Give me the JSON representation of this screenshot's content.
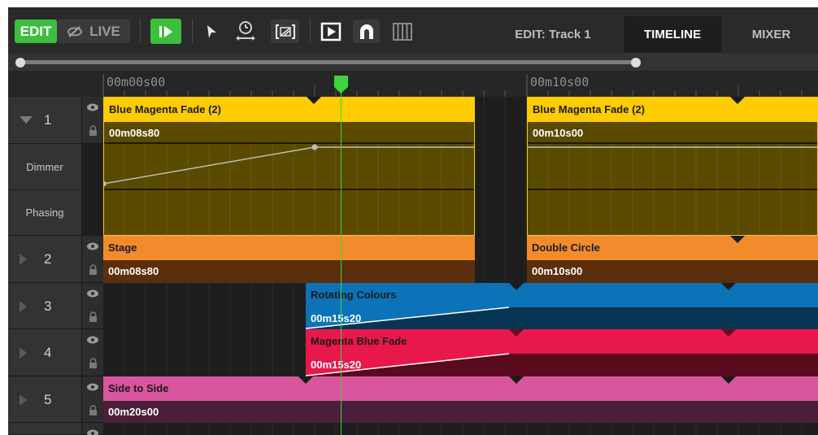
{
  "toolbar": {
    "edit_label": "EDIT",
    "live_label": "LIVE",
    "icons": [
      "eye-off-icon",
      "play-icon",
      "pointer-icon",
      "time-stretch-icon",
      "select-region-icon",
      "preview-icon",
      "magnet-icon",
      "grid-icon"
    ]
  },
  "tabs": [
    {
      "label": "EDIT: Track 1",
      "active": false
    },
    {
      "label": "TIMELINE",
      "active": true
    },
    {
      "label": "MIXER",
      "active": false
    }
  ],
  "ruler": {
    "marks": [
      "00m00s00",
      "00m10s00"
    ]
  },
  "tracks": [
    {
      "number": "1",
      "expanded": true,
      "lanes": [
        "Dimmer",
        "Phasing"
      ],
      "blocks": [
        {
          "name": "Blue Magenta Fade (2)",
          "duration": "00m08s80"
        },
        {
          "name": "Blue Magenta Fade (2)",
          "duration": "00m10s00"
        }
      ]
    },
    {
      "number": "2",
      "expanded": false,
      "blocks": [
        {
          "name": "Stage",
          "duration": "00m08s80"
        },
        {
          "name": "Double Circle",
          "duration": "00m10s00"
        }
      ]
    },
    {
      "number": "3",
      "expanded": false,
      "blocks": [
        {
          "name": "Rotating Colours",
          "duration": "00m15s20"
        }
      ]
    },
    {
      "number": "4",
      "expanded": false,
      "blocks": [
        {
          "name": "Magenta Blue Fade",
          "duration": "00m15s20"
        }
      ]
    },
    {
      "number": "5",
      "expanded": false,
      "blocks": [
        {
          "name": "Side to Side",
          "duration": "00m20s00"
        }
      ]
    }
  ],
  "colors": {
    "accent_green": "#3dbf3d",
    "yellow": "#ffcc00",
    "orange": "#f28b2c",
    "blue": "#0c73b8",
    "red": "#e8184a",
    "pink": "#d9569e"
  }
}
